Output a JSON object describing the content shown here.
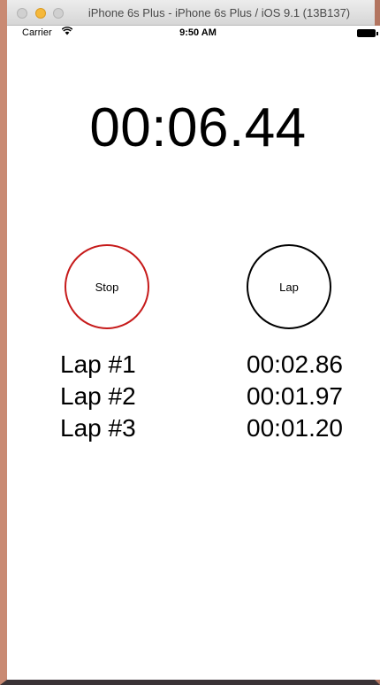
{
  "window": {
    "title": "iPhone 6s Plus - iPhone 6s Plus / iOS 9.1 (13B137)"
  },
  "status_bar": {
    "carrier": "Carrier",
    "time": "9:50 AM"
  },
  "stopwatch": {
    "elapsed": "00:06.44",
    "stop_label": "Stop",
    "lap_label": "Lap"
  },
  "laps": [
    {
      "label": "Lap #1",
      "time": "00:02.86"
    },
    {
      "label": "Lap #2",
      "time": "00:01.97"
    },
    {
      "label": "Lap #3",
      "time": "00:01.20"
    }
  ],
  "colors": {
    "stop_border": "#c61a1a",
    "lap_border": "#000000",
    "minimize_button": "#f5b83a"
  },
  "icons": {
    "wifi": "wifi-icon",
    "battery": "battery-icon"
  }
}
